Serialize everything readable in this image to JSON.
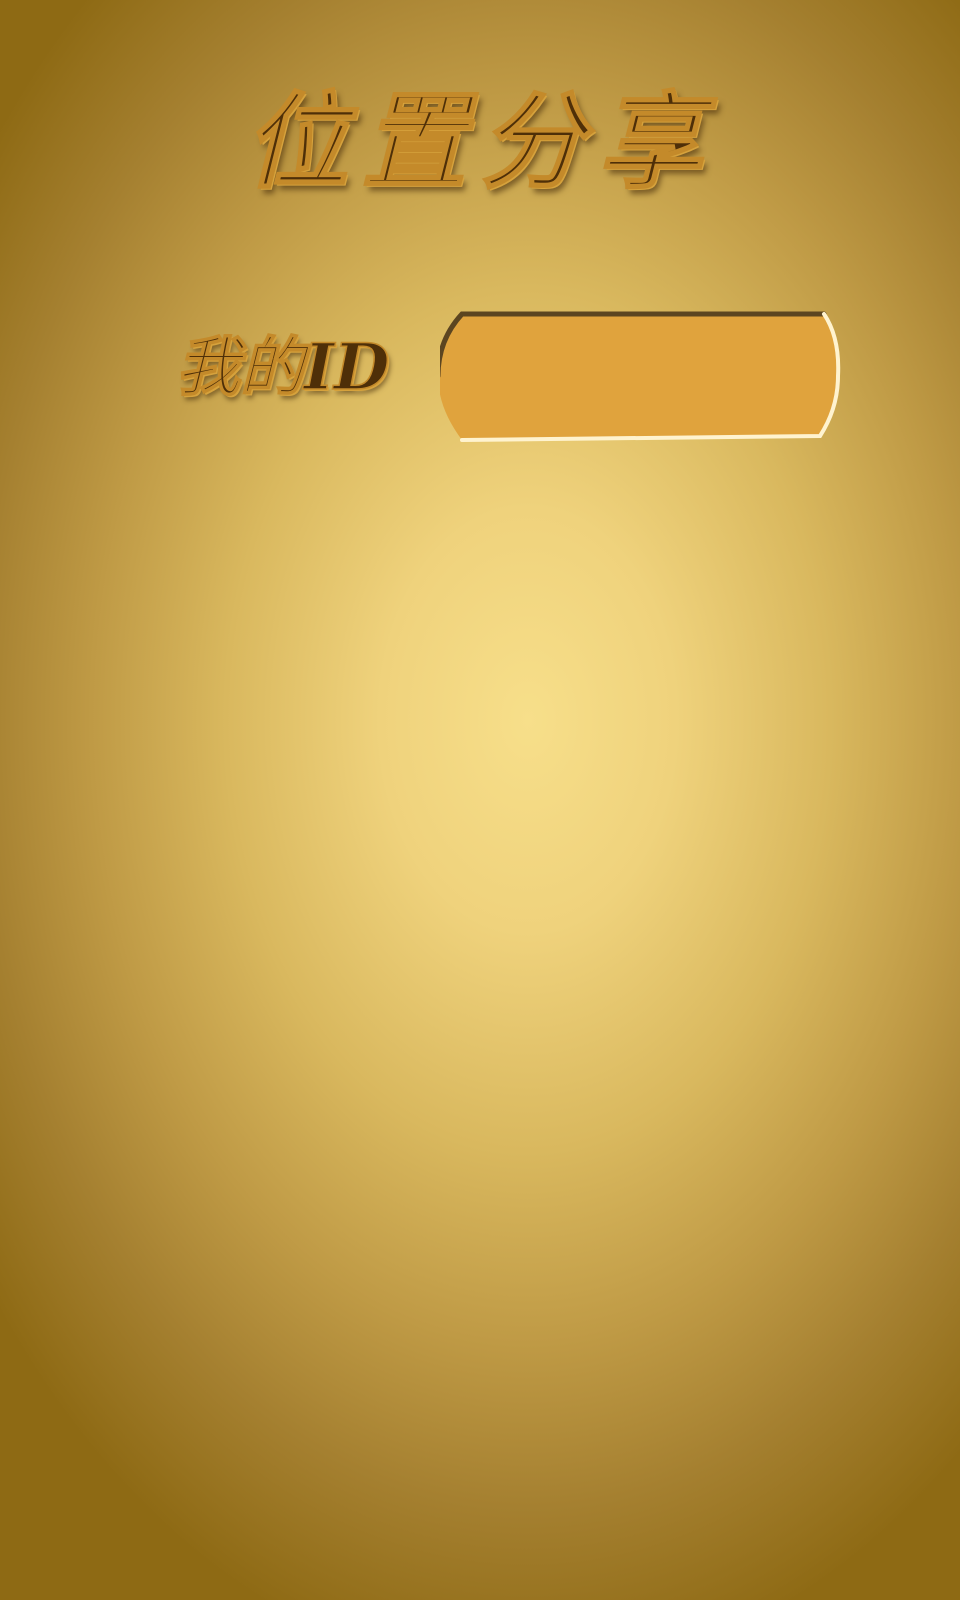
{
  "header": {
    "title": "位置分享"
  },
  "form": {
    "id_label": "我的ID",
    "id_value": "",
    "id_placeholder": ""
  },
  "colors": {
    "background_center": "#f7df8a",
    "background_edge": "#8e6a14",
    "text": "#4e2f08",
    "input_fill": "#e0a33d"
  }
}
